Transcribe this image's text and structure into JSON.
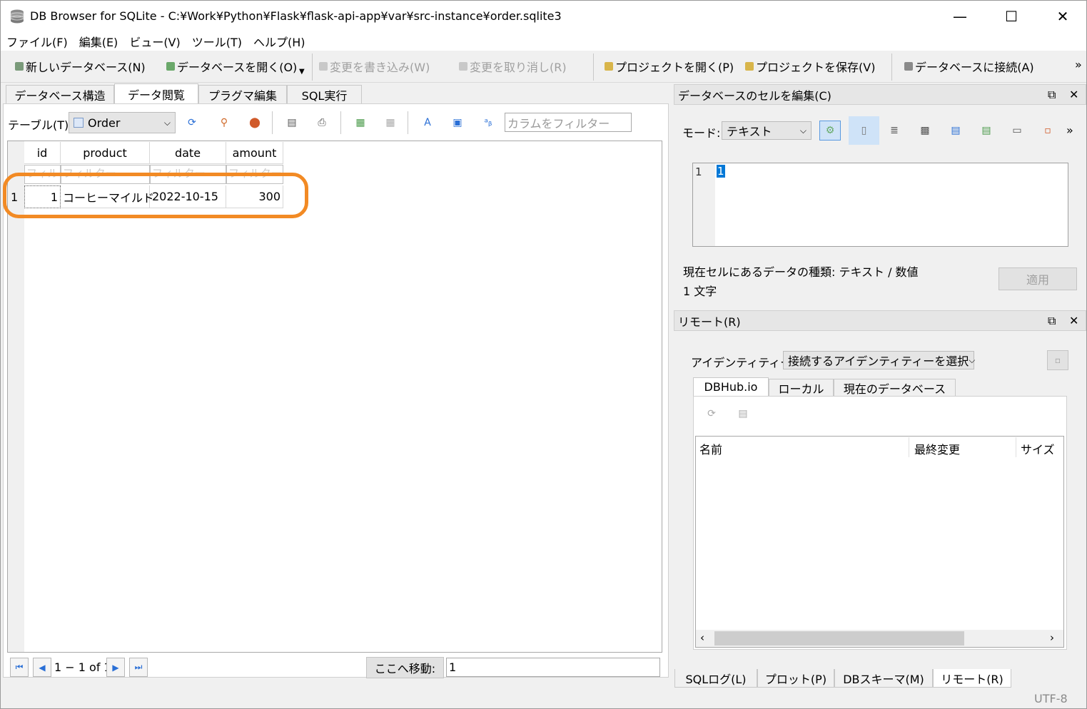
{
  "window": {
    "title": "DB Browser for SQLite - C:¥Work¥Python¥Flask¥flask-api-app¥var¥src-instance¥order.sqlite3",
    "minimize": "—",
    "maximize": "☐",
    "close": "✕"
  },
  "menu": [
    "ファイル(F)",
    "編集(E)",
    "ビュー(V)",
    "ツール(T)",
    "ヘルプ(H)"
  ],
  "toolbar": {
    "new_db": "新しいデータベース(N)",
    "open_db": "データベースを開く(O)",
    "write_changes": "変更を書き込み(W)",
    "revert_changes": "変更を取り消し(R)",
    "open_project": "プロジェクトを開く(P)",
    "save_project": "プロジェクトを保存(V)",
    "attach_db": "データベースに接続(A)",
    "more": "»"
  },
  "tabs": [
    "データベース構造",
    "データ閲覧",
    "プラグマ編集",
    "SQL実行"
  ],
  "browse": {
    "table_label": "テーブル(T):",
    "table_value": "Order",
    "column_filter_placeholder": "カラムをフィルター",
    "columns": [
      "id",
      "product",
      "date",
      "amount"
    ],
    "filter_placeholder": "フィルター",
    "rows": [
      {
        "rownum": "1",
        "id": "1",
        "product": "コーヒーマイルド",
        "date": "2022-10-15",
        "amount": "300"
      }
    ],
    "pager_text": "1 − 1 of 1",
    "goto_label": "ここへ移動:",
    "goto_value": "1"
  },
  "edit_cell": {
    "title": "データベースのセルを編集(C)",
    "mode_label": "モード:",
    "mode_value": "テキスト",
    "line_number": "1",
    "cell_value": "1",
    "type_info": "現在セルにあるデータの種類: テキスト / 数値",
    "length_info": "1 文字",
    "apply": "適用",
    "more": "»"
  },
  "remote": {
    "title": "リモート(R)",
    "identity_label": "アイデンティティー",
    "identity_value": "接続するアイデンティティーを選択",
    "tabs": [
      "DBHub.io",
      "ローカル",
      "現在のデータベース"
    ],
    "columns": [
      "名前",
      "最終変更",
      "サイズ"
    ]
  },
  "bottom_tabs": [
    "SQLログ(L)",
    "プロット(P)",
    "DBスキーマ(M)",
    "リモート(R)"
  ],
  "status": {
    "encoding": "UTF-8"
  },
  "colors": {
    "highlight": "#f28a24",
    "selection": "#0078d7"
  }
}
